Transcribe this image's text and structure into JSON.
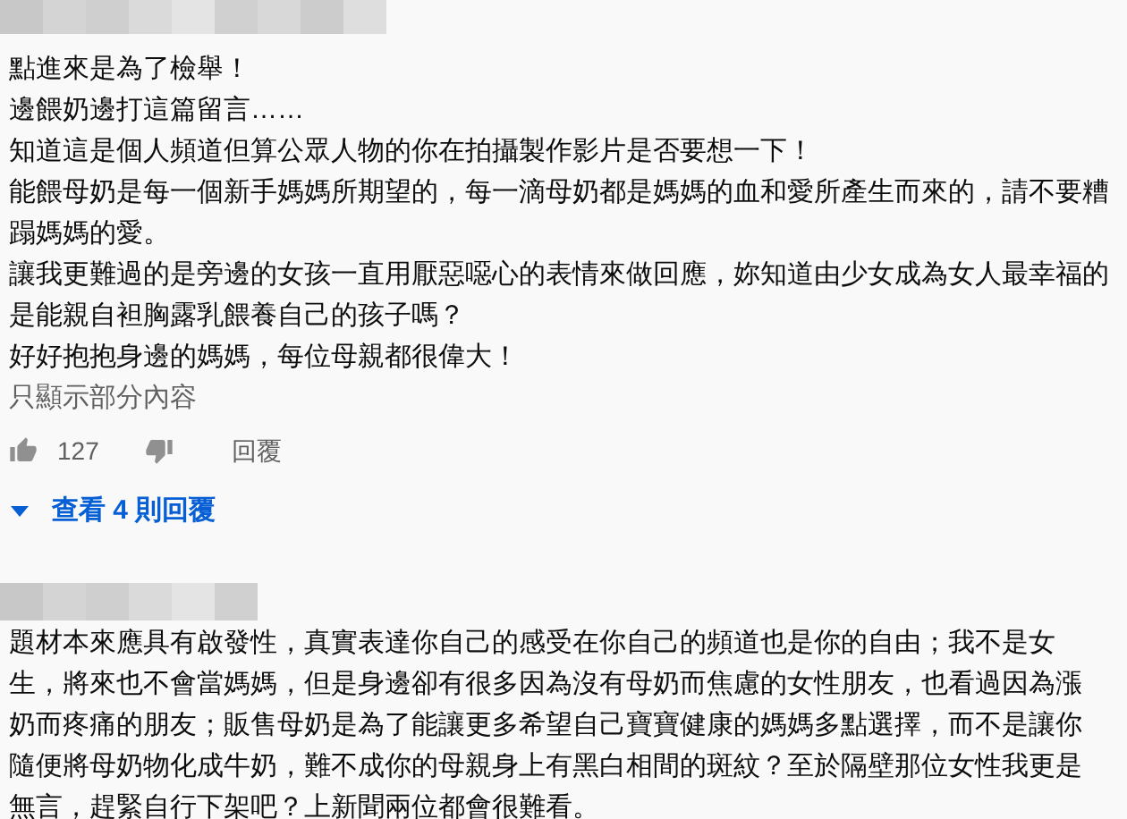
{
  "comments": [
    {
      "paragraphs": [
        "點進來是為了檢舉！",
        "邊餵奶邊打這篇留言……",
        "知道這是個人頻道但算公眾人物的你在拍攝製作影片是否要想一下！",
        "能餵母奶是每一個新手媽媽所期望的，每一滴母奶都是媽媽的血和愛所產生而來的，請不要糟蹋媽媽的愛。",
        "讓我更難過的是旁邊的女孩一直用厭惡噁心的表情來做回應，妳知道由少女成為女人最幸福的是能親自袒胸露乳餵養自己的孩子嗎？",
        "好好抱抱身邊的媽媽，每位母親都很偉大！"
      ],
      "read_more": "只顯示部分內容",
      "likes": "127",
      "reply": "回覆",
      "view_replies": "查看 4 則回覆"
    },
    {
      "paragraphs": [
        "題材本來應具有啟發性，真實表達你自己的感受在你自己的頻道也是你的自由；我不是女生，將來也不會當媽媽，但是身邊卻有很多因為沒有母奶而焦慮的女性朋友，也看過因為漲奶而疼痛的朋友；販售母奶是為了能讓更多希望自己寶寶健康的媽媽多點選擇，而不是讓你隨便將母奶物化成牛奶，難不成你的母親身上有黑白相間的斑紋？至於隔壁那位女性我更是無言，趕緊自行下架吧？上新聞兩位都會很難看。"
      ]
    }
  ]
}
